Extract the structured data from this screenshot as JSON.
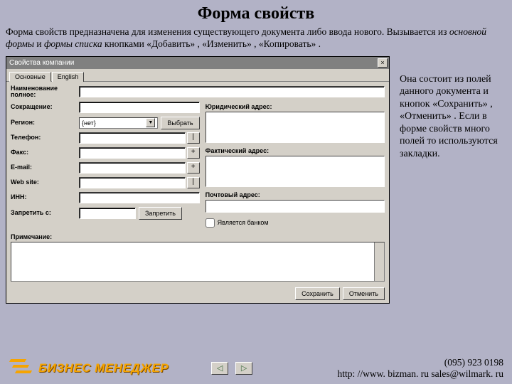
{
  "page": {
    "title": "Форма свойств",
    "intro_1a": "Форма свойств предназначена для изменения существующего документа либо ввода нового. Вызывается из ",
    "intro_em1": "основной формы",
    "intro_mid": " и ",
    "intro_em2": "формы списка",
    "intro_1b": " кнопками «Добавить» , «Изменить» , «Копировать» ."
  },
  "dialog": {
    "title": "Свойства компании",
    "close": "×",
    "tabs": {
      "t1": "Основные",
      "t2": "English"
    },
    "labels": {
      "name_full": "Наименование полное:",
      "name_short": "Сокращение:",
      "region": "Регион:",
      "phone": "Телефон:",
      "fax": "Факс:",
      "email": "E-mail:",
      "web": "Web site:",
      "inn": "ИНН:",
      "deny": "Запретить с:",
      "addr_legal": "Юридический адрес:",
      "addr_fact": "Фактический адрес:",
      "addr_post": "Почтовый адрес:",
      "bank_flag": "Является банком",
      "note": "Примечание:"
    },
    "region_value": "{нет}",
    "small": {
      "goto": "|",
      "plus": "+"
    },
    "btn": {
      "select": "Выбрать",
      "deny": "Запретить",
      "save": "Сохранить",
      "cancel": "Отменить"
    }
  },
  "desc": {
    "text": "Она состоит из полей данного документа и кнопок «Сохранить» , «Отменить» . Если в форме свойств много полей то используются закладки."
  },
  "footer": {
    "brand": "БИЗНЕС МЕНЕДЖЕР",
    "phone": "(095) 923 0198",
    "links": "http: //www. bizman. ru  sales@wilmark. ru"
  }
}
